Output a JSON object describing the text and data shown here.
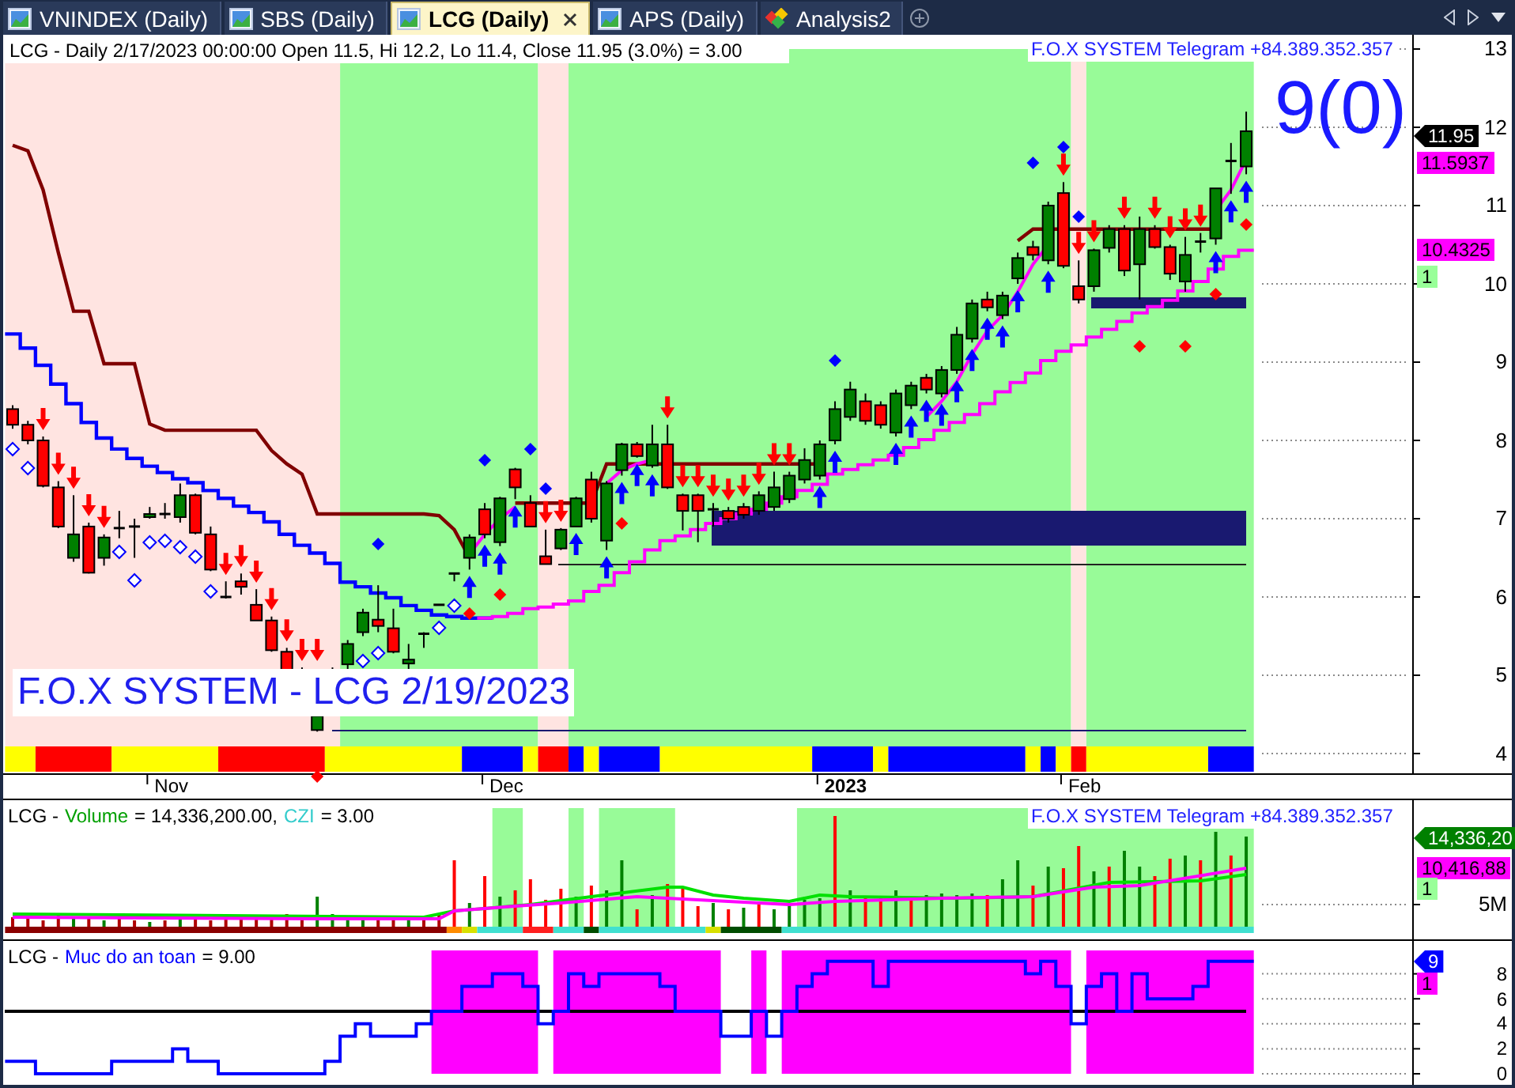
{
  "tabs": [
    {
      "label": "VNINDEX (Daily)",
      "kind": "chart",
      "selected": false
    },
    {
      "label": "SBS (Daily)",
      "kind": "chart",
      "selected": false
    },
    {
      "label": "LCG (Daily)",
      "kind": "chart",
      "selected": true
    },
    {
      "label": "APS (Daily)",
      "kind": "chart",
      "selected": false
    },
    {
      "label": "Analysis2",
      "kind": "analysis",
      "selected": false
    }
  ],
  "price_pane": {
    "legend": "LCG - Daily 2/17/2023 00:00:00 Open 11.5, Hi 12.2, Lo 11.4, Close 11.95 (3.0%) = 3.00",
    "banner": "F.O.X SYSTEM Telegram +84.389.352.357",
    "signal_count": "9(0)",
    "caption": "F.O.X SYSTEM - LCG 2/19/2023",
    "y_axis_labels": [
      "13",
      "12",
      "11",
      "10",
      "9",
      "8",
      "7",
      "6",
      "5",
      "4"
    ],
    "x_axis_labels": [
      {
        "text": "Nov",
        "kind": "month"
      },
      {
        "text": "Dec",
        "kind": "month"
      },
      {
        "text": "2023",
        "kind": "year"
      },
      {
        "text": "Feb",
        "kind": "month"
      }
    ],
    "tags": [
      {
        "text": "11.95",
        "kind": "pointer",
        "color": "#000000"
      },
      {
        "text": "11.5937",
        "kind": "box",
        "color": "#ff00ff"
      },
      {
        "text": "10.4325",
        "kind": "box",
        "color": "#ff00ff"
      },
      {
        "text": "1",
        "kind": "box",
        "color": "#99ff99"
      }
    ]
  },
  "volume_pane": {
    "legend": {
      "symbol": "LCG -",
      "items": [
        {
          "name": "Volume",
          "value": "= 14,336,200.00,",
          "color": "#00a000"
        },
        {
          "name": "CZI",
          "value": "= 3.00",
          "color": "#33cccc"
        }
      ]
    },
    "banner": "F.O.X SYSTEM Telegram +84.389.352.357",
    "y_axis_labels": [
      "5M"
    ],
    "tags": [
      {
        "text": "14,336,20",
        "kind": "pointer",
        "color": "#008000"
      },
      {
        "text": "10,416,88",
        "kind": "box",
        "color": "#ff00ff"
      },
      {
        "text": "1",
        "kind": "box",
        "color": "#99ff99"
      }
    ]
  },
  "safety_pane": {
    "legend": {
      "symbol": "LCG -",
      "items": [
        {
          "name": "Muc do an toan",
          "value": "= 9.00",
          "color": "#0000ff"
        }
      ]
    },
    "y_axis_labels": [
      "8",
      "6",
      "4",
      "2",
      "0"
    ],
    "tags": [
      {
        "text": "9",
        "kind": "pointer",
        "color": "#0000ff"
      },
      {
        "text": "1",
        "kind": "box",
        "color": "#ff00ff"
      }
    ]
  }
}
